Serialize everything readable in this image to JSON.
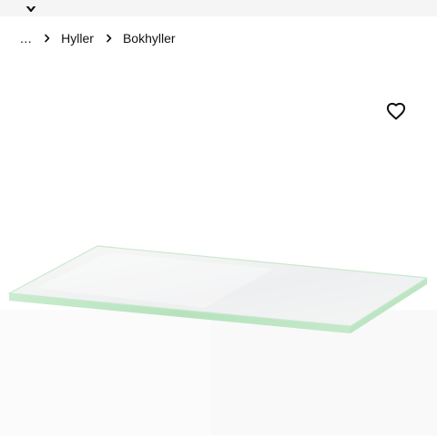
{
  "breadcrumb": {
    "ellipsis": "...",
    "items": [
      {
        "label": "Hyller"
      },
      {
        "label": "Bokhyller"
      }
    ]
  },
  "icons": {
    "top": "chevron-down-icon",
    "separator": "chevron-right-icon",
    "favourite": "heart-outline-icon"
  },
  "colors": {
    "background": "#ffffff",
    "topbar": "#f5f5f5",
    "text": "#111111",
    "glass_edge": "#bfe6c4"
  }
}
